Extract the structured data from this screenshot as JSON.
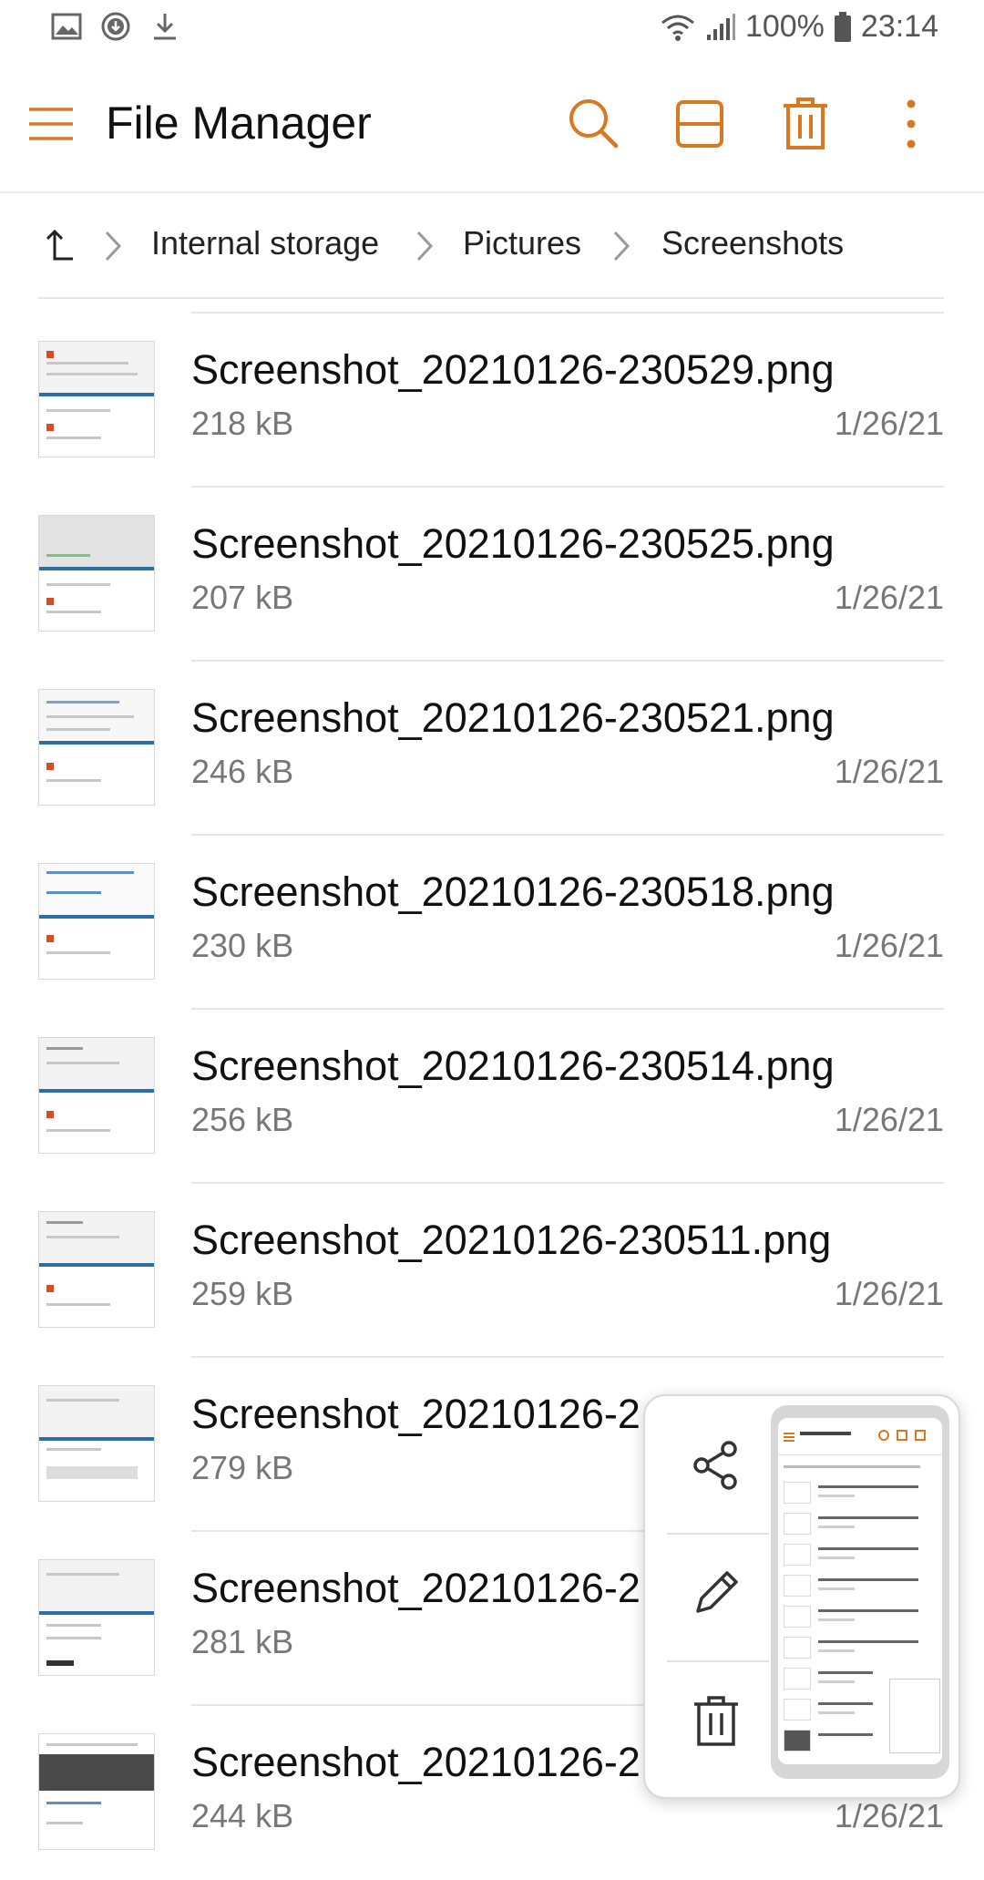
{
  "status_bar": {
    "battery_text": "100%",
    "time": "23:14",
    "left_icons": [
      "gallery-icon",
      "download-circle-icon",
      "download-icon"
    ],
    "right_icons": [
      "wifi-icon",
      "signal-icon",
      "battery-icon"
    ]
  },
  "app_bar": {
    "title": "File Manager",
    "actions": [
      "search-icon",
      "view-toggle-icon",
      "delete-icon",
      "more-options-icon"
    ],
    "accent_color": "#d9781e"
  },
  "breadcrumb": {
    "items": [
      "Internal storage",
      "Pictures",
      "Screenshots"
    ]
  },
  "files": [
    {
      "name": "Screenshot_20210126-230529.png",
      "size": "218 kB",
      "date": "1/26/21"
    },
    {
      "name": "Screenshot_20210126-230525.png",
      "size": "207 kB",
      "date": "1/26/21"
    },
    {
      "name": "Screenshot_20210126-230521.png",
      "size": "246 kB",
      "date": "1/26/21"
    },
    {
      "name": "Screenshot_20210126-230518.png",
      "size": "230 kB",
      "date": "1/26/21"
    },
    {
      "name": "Screenshot_20210126-230514.png",
      "size": "256 kB",
      "date": "1/26/21"
    },
    {
      "name": "Screenshot_20210126-230511.png",
      "size": "259 kB",
      "date": "1/26/21"
    },
    {
      "name": "Screenshot_20210126-2",
      "size": "279 kB",
      "date": ""
    },
    {
      "name": "Screenshot_20210126-2",
      "size": "281 kB",
      "date": ""
    },
    {
      "name": "Screenshot_20210126-2",
      "size": "244 kB",
      "date": "1/26/21"
    }
  ],
  "preview_popup": {
    "actions": [
      "share-icon",
      "edit-icon",
      "delete-icon"
    ]
  }
}
